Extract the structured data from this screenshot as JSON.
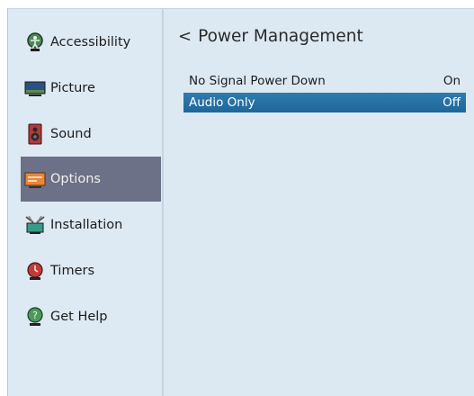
{
  "sidebar": {
    "items": [
      {
        "label": "Accessibility",
        "icon": "accessibility-icon"
      },
      {
        "label": "Picture",
        "icon": "picture-icon"
      },
      {
        "label": "Sound",
        "icon": "sound-icon"
      },
      {
        "label": "Options",
        "icon": "options-icon",
        "active": true
      },
      {
        "label": "Installation",
        "icon": "installation-icon"
      },
      {
        "label": "Timers",
        "icon": "timers-icon"
      },
      {
        "label": "Get Help",
        "icon": "get-help-icon"
      }
    ]
  },
  "main": {
    "back_chevron": "<",
    "title": "Power Management",
    "rows": [
      {
        "label": "No Signal Power Down",
        "value": "On"
      },
      {
        "label": "Audio Only",
        "value": "Off",
        "selected": true
      }
    ]
  },
  "colors": {
    "background": "#dce9f3",
    "active_nav": "#6c7187",
    "selection": "#2673a6"
  }
}
